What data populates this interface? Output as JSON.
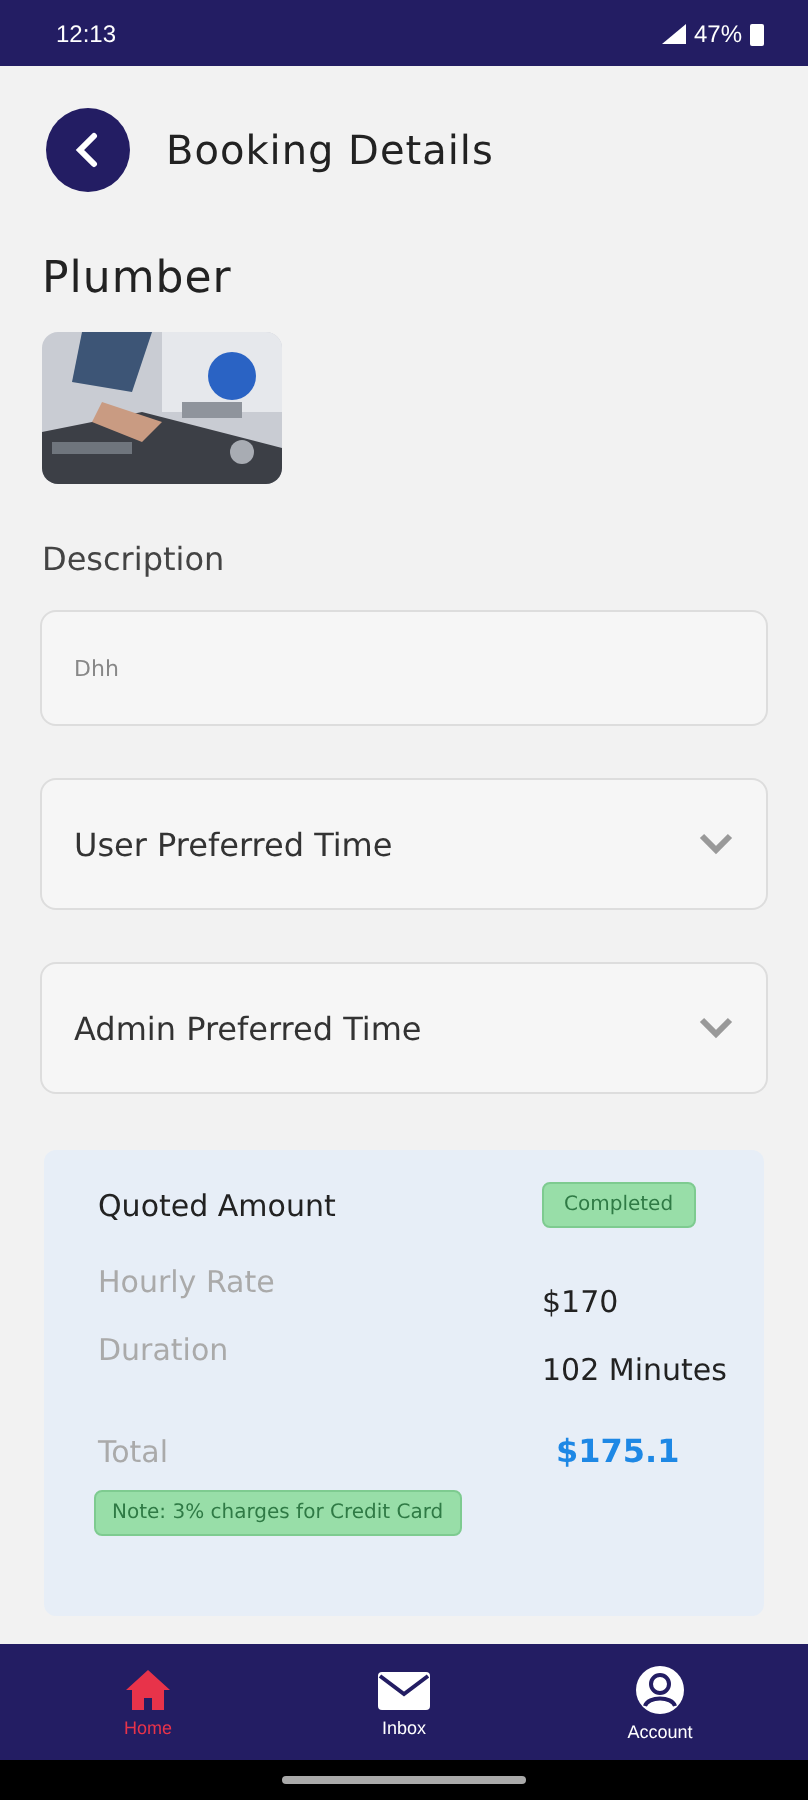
{
  "status_bar": {
    "time": "12:13",
    "battery": "47%"
  },
  "header": {
    "title": "Booking Details"
  },
  "service": {
    "title": "Plumber"
  },
  "description": {
    "label": "Description",
    "placeholder": "Dhh"
  },
  "dropdowns": [
    {
      "label": "User Preferred Time",
      "expanded": false
    },
    {
      "label": "Admin Preferred Time",
      "expanded": false
    }
  ],
  "quote": {
    "title": "Quoted Amount",
    "status": "Completed",
    "rows": [
      {
        "label": "Hourly Rate",
        "value": "$170"
      },
      {
        "label": "Duration",
        "value": "102 Minutes"
      }
    ],
    "total_label": "Total",
    "total_value": "$175.1",
    "note": "Note: 3% charges for Credit Card"
  },
  "bottom_nav": [
    {
      "label": "Home",
      "kind": "home",
      "selected": true
    },
    {
      "label": "Inbox",
      "kind": "inbox",
      "selected": false
    },
    {
      "label": "Account",
      "kind": "account",
      "selected": false
    }
  ]
}
